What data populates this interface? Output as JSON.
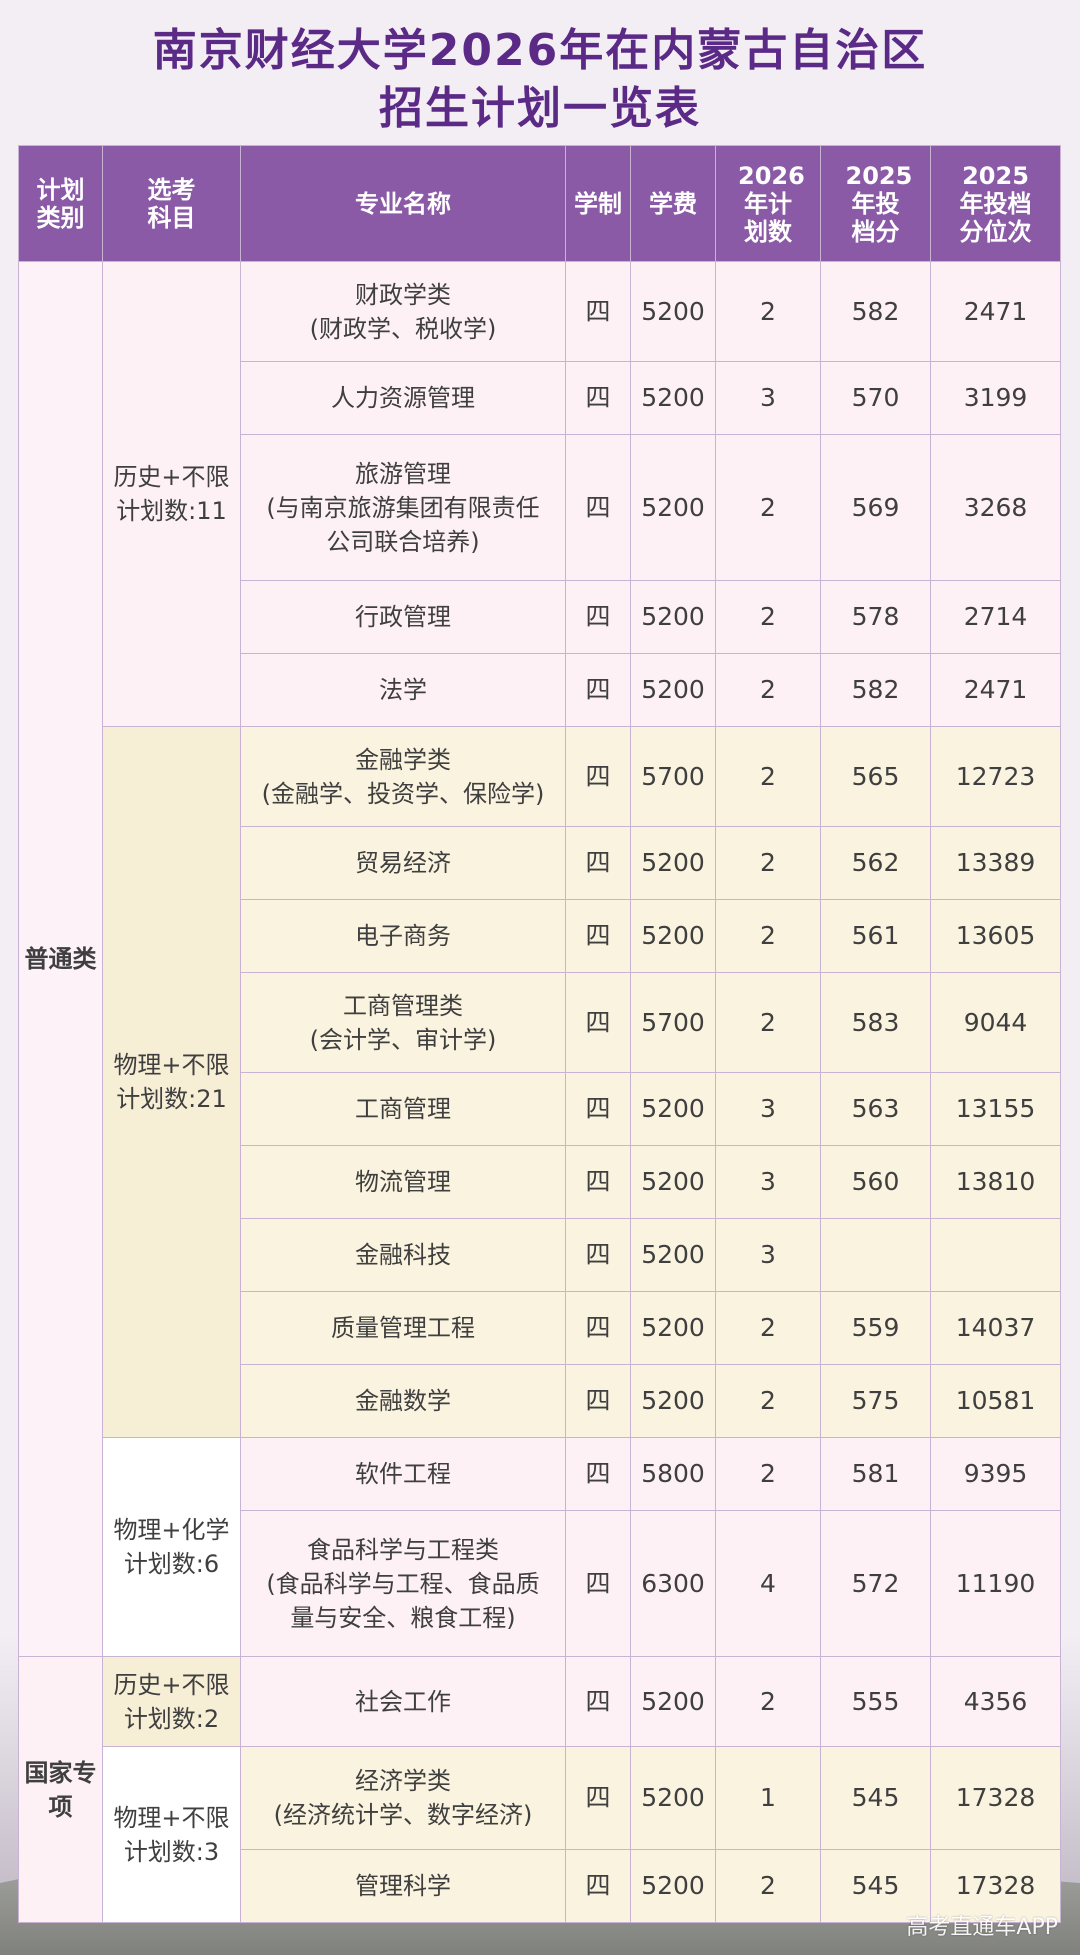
{
  "title": {
    "line1": "南京财经大学2026年在内蒙古自治区",
    "line2": "招生计划一览表"
  },
  "headers": {
    "category": "计划类别",
    "subject": "选考科目",
    "major": "专业名称",
    "duration": "学制",
    "tuition": "学费",
    "plan2026": "2026年计划数",
    "score2025": "2025年投档分",
    "rank2025": "2025年投档分位次"
  },
  "categories": {
    "general": "普通类",
    "national": "国家专项"
  },
  "groups": {
    "g1": "历史+不限\n计划数:11",
    "g2": "物理+不限\n计划数:21",
    "g3": "物理+化学\n计划数:6",
    "g4": "历史+不限\n计划数:2",
    "g5": "物理+不限\n计划数:3"
  },
  "rows": [
    {
      "major": "财政学类\n(财政学、税收学)",
      "duration": "四",
      "tuition": "5200",
      "plan": "2",
      "score": "582",
      "rank": "2471"
    },
    {
      "major": "人力资源管理",
      "duration": "四",
      "tuition": "5200",
      "plan": "3",
      "score": "570",
      "rank": "3199"
    },
    {
      "major": "旅游管理\n(与南京旅游集团有限责任\n公司联合培养)",
      "duration": "四",
      "tuition": "5200",
      "plan": "2",
      "score": "569",
      "rank": "3268"
    },
    {
      "major": "行政管理",
      "duration": "四",
      "tuition": "5200",
      "plan": "2",
      "score": "578",
      "rank": "2714"
    },
    {
      "major": "法学",
      "duration": "四",
      "tuition": "5200",
      "plan": "2",
      "score": "582",
      "rank": "2471"
    },
    {
      "major": "金融学类\n(金融学、投资学、保险学)",
      "duration": "四",
      "tuition": "5700",
      "plan": "2",
      "score": "565",
      "rank": "12723"
    },
    {
      "major": "贸易经济",
      "duration": "四",
      "tuition": "5200",
      "plan": "2",
      "score": "562",
      "rank": "13389"
    },
    {
      "major": "电子商务",
      "duration": "四",
      "tuition": "5200",
      "plan": "2",
      "score": "561",
      "rank": "13605"
    },
    {
      "major": "工商管理类\n(会计学、审计学)",
      "duration": "四",
      "tuition": "5700",
      "plan": "2",
      "score": "583",
      "rank": "9044"
    },
    {
      "major": "工商管理",
      "duration": "四",
      "tuition": "5200",
      "plan": "3",
      "score": "563",
      "rank": "13155"
    },
    {
      "major": "物流管理",
      "duration": "四",
      "tuition": "5200",
      "plan": "3",
      "score": "560",
      "rank": "13810"
    },
    {
      "major": "金融科技",
      "duration": "四",
      "tuition": "5200",
      "plan": "3",
      "score": "",
      "rank": ""
    },
    {
      "major": "质量管理工程",
      "duration": "四",
      "tuition": "5200",
      "plan": "2",
      "score": "559",
      "rank": "14037"
    },
    {
      "major": "金融数学",
      "duration": "四",
      "tuition": "5200",
      "plan": "2",
      "score": "575",
      "rank": "10581"
    },
    {
      "major": "软件工程",
      "duration": "四",
      "tuition": "5800",
      "plan": "2",
      "score": "581",
      "rank": "9395"
    },
    {
      "major": "食品科学与工程类\n(食品科学与工程、食品质\n量与安全、粮食工程)",
      "duration": "四",
      "tuition": "6300",
      "plan": "4",
      "score": "572",
      "rank": "11190"
    },
    {
      "major": "社会工作",
      "duration": "四",
      "tuition": "5200",
      "plan": "2",
      "score": "555",
      "rank": "4356"
    },
    {
      "major": "经济学类\n(经济统计学、数字经济)",
      "duration": "四",
      "tuition": "5200",
      "plan": "1",
      "score": "545",
      "rank": "17328"
    },
    {
      "major": "管理科学",
      "duration": "四",
      "tuition": "5200",
      "plan": "2",
      "score": "545",
      "rank": "17328"
    }
  ],
  "watermark": "高考直通车APP"
}
